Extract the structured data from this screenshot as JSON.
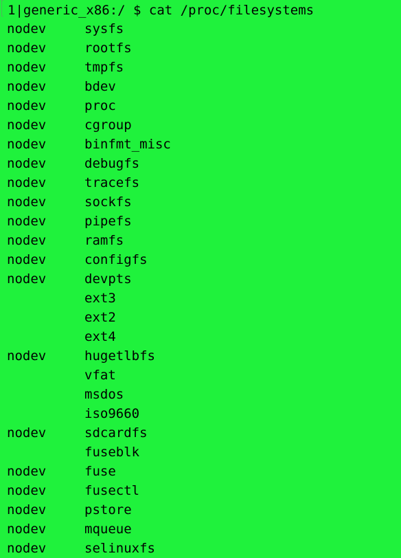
{
  "terminal": {
    "prompt": "1|generic_x86:/ $ cat /proc/filesystems",
    "background": "#1ff23c",
    "foreground": "#000000",
    "rows": [
      {
        "dev": "nodev",
        "name": "sysfs"
      },
      {
        "dev": "nodev",
        "name": "rootfs"
      },
      {
        "dev": "nodev",
        "name": "tmpfs"
      },
      {
        "dev": "nodev",
        "name": "bdev"
      },
      {
        "dev": "nodev",
        "name": "proc"
      },
      {
        "dev": "nodev",
        "name": "cgroup"
      },
      {
        "dev": "nodev",
        "name": "binfmt_misc"
      },
      {
        "dev": "nodev",
        "name": "debugfs"
      },
      {
        "dev": "nodev",
        "name": "tracefs"
      },
      {
        "dev": "nodev",
        "name": "sockfs"
      },
      {
        "dev": "nodev",
        "name": "pipefs"
      },
      {
        "dev": "nodev",
        "name": "ramfs"
      },
      {
        "dev": "nodev",
        "name": "configfs"
      },
      {
        "dev": "nodev",
        "name": "devpts"
      },
      {
        "dev": "",
        "name": "ext3"
      },
      {
        "dev": "",
        "name": "ext2"
      },
      {
        "dev": "",
        "name": "ext4"
      },
      {
        "dev": "nodev",
        "name": "hugetlbfs"
      },
      {
        "dev": "",
        "name": "vfat"
      },
      {
        "dev": "",
        "name": "msdos"
      },
      {
        "dev": "",
        "name": "iso9660"
      },
      {
        "dev": "nodev",
        "name": "sdcardfs"
      },
      {
        "dev": "",
        "name": "fuseblk"
      },
      {
        "dev": "nodev",
        "name": "fuse"
      },
      {
        "dev": "nodev",
        "name": "fusectl"
      },
      {
        "dev": "nodev",
        "name": "pstore"
      },
      {
        "dev": "nodev",
        "name": "mqueue"
      },
      {
        "dev": "nodev",
        "name": "selinuxfs"
      }
    ]
  }
}
